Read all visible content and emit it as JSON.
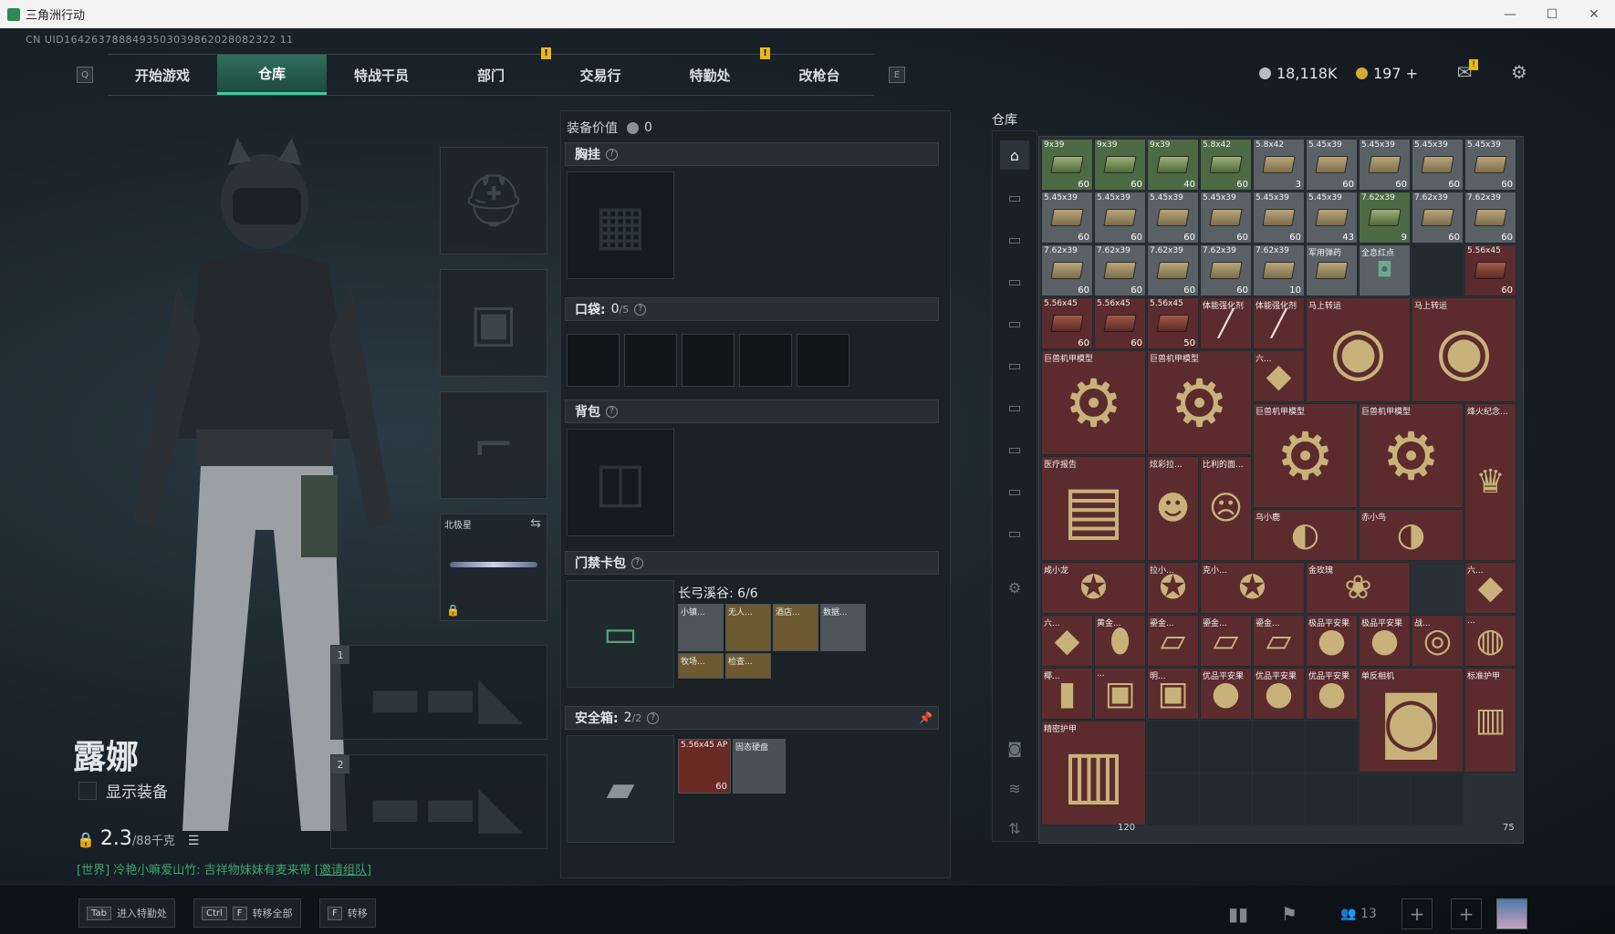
{
  "window": {
    "title": "三角洲行动",
    "controls": [
      "—",
      "☐",
      "✕"
    ]
  },
  "uid": "CN UID1642637888493503039862028082322 11",
  "nav": {
    "left_key": "Q",
    "right_key": "E",
    "tabs": [
      {
        "label": "开始游戏",
        "active": false,
        "alert": false
      },
      {
        "label": "仓库",
        "active": true,
        "alert": false
      },
      {
        "label": "特战干员",
        "active": false,
        "alert": false
      },
      {
        "label": "部门",
        "active": false,
        "alert": true
      },
      {
        "label": "交易行",
        "active": false,
        "alert": false
      },
      {
        "label": "特勤处",
        "active": false,
        "alert": true
      },
      {
        "label": "改枪台",
        "active": false,
        "alert": false
      }
    ],
    "alert_mark": "!"
  },
  "currency": {
    "silver": "18,118K",
    "gold": "197 +"
  },
  "icons": {
    "mail": "mail-icon",
    "settings": "gear-icon"
  },
  "character": {
    "name": "露娜",
    "show_equipment": "显示装备",
    "weight": "2.3",
    "weight_max": "/88千克"
  },
  "chat": {
    "prefix": "[世界] 冷艳小嘛爱山竹: 吉祥物妹妹有麦来带 ",
    "link": "[邀请组队]"
  },
  "gear": {
    "melee_label": "北极星",
    "weapon_slot_1": "1",
    "weapon_slot_2": "2"
  },
  "equipment": {
    "value_label": "装备价值",
    "value": "0",
    "chest_rig": "胸挂",
    "pockets": "口袋:",
    "pockets_count": "0",
    "pockets_max": "/5",
    "backpack": "背包",
    "keycard": "门禁卡包",
    "keycard_map": "长弓溪谷: 6/6",
    "keycard_items": [
      "小镇...",
      "无人...",
      "酒店...",
      "数据...",
      "牧场...",
      "检查..."
    ],
    "safe_box": "安全箱:",
    "safe_count": "2",
    "safe_max": "/2",
    "safe_items": [
      {
        "name": "5.56x45 AP",
        "count": "60"
      },
      {
        "name": "固态硬盘",
        "count": ""
      }
    ],
    "help_mark": "?"
  },
  "warehouse": {
    "title": "仓库",
    "cells": [
      {
        "name": "9x39",
        "count": "60",
        "color": "green",
        "kind": "boxg"
      },
      {
        "name": "9x39",
        "count": "60",
        "color": "green",
        "kind": "boxg"
      },
      {
        "name": "9x39",
        "count": "40",
        "color": "green",
        "kind": "boxg"
      },
      {
        "name": "5.8x42",
        "count": "60",
        "color": "green",
        "kind": "boxg"
      },
      {
        "name": "5.8x42",
        "count": "3",
        "color": "gray",
        "kind": "box"
      },
      {
        "name": "5.45x39",
        "count": "60",
        "color": "gray",
        "kind": "box"
      },
      {
        "name": "5.45x39",
        "count": "60",
        "color": "gray",
        "kind": "box"
      },
      {
        "name": "5.45x39",
        "count": "60",
        "color": "gray",
        "kind": "box"
      },
      {
        "name": "5.45x39",
        "count": "60",
        "color": "gray",
        "kind": "box"
      },
      {
        "name": "5.45x39",
        "count": "60",
        "color": "gray",
        "kind": "box"
      },
      {
        "name": "5.45x39",
        "count": "60",
        "color": "gray",
        "kind": "box"
      },
      {
        "name": "5.45x39",
        "count": "60",
        "color": "gray",
        "kind": "box"
      },
      {
        "name": "5.45x39",
        "count": "60",
        "color": "gray",
        "kind": "box"
      },
      {
        "name": "5.45x39",
        "count": "60",
        "color": "gray",
        "kind": "box"
      },
      {
        "name": "5.45x39",
        "count": "43",
        "color": "gray",
        "kind": "box"
      },
      {
        "name": "7.62x39",
        "count": "9",
        "color": "green",
        "kind": "boxg"
      },
      {
        "name": "7.62x39",
        "count": "60",
        "color": "gray",
        "kind": "box"
      },
      {
        "name": "7.62x39",
        "count": "60",
        "color": "gray",
        "kind": "box"
      },
      {
        "name": "7.62x39",
        "count": "60",
        "color": "gray",
        "kind": "box"
      },
      {
        "name": "7.62x39",
        "count": "60",
        "color": "gray",
        "kind": "box"
      },
      {
        "name": "7.62x39",
        "count": "60",
        "color": "gray",
        "kind": "box"
      },
      {
        "name": "7.62x39",
        "count": "60",
        "color": "gray",
        "kind": "box"
      },
      {
        "name": "7.62x39",
        "count": "10",
        "color": "gray",
        "kind": "box"
      },
      {
        "name": "军用弹药",
        "count": "",
        "color": "gray",
        "kind": "box"
      },
      {
        "name": "全息红点",
        "count": "",
        "color": "gray",
        "kind": "sight"
      },
      {
        "name": "",
        "count": "",
        "color": "empty",
        "kind": ""
      },
      {
        "name": "5.56x45",
        "count": "60",
        "color": "red",
        "kind": "boxr"
      },
      {
        "name": "5.56x45",
        "count": "60",
        "color": "red",
        "kind": "boxr"
      },
      {
        "name": "5.56x45",
        "count": "60",
        "color": "red",
        "kind": "boxr"
      },
      {
        "name": "5.56x45",
        "count": "50",
        "color": "red",
        "kind": "boxr"
      },
      {
        "name": "体能强化剂",
        "count": "",
        "color": "red",
        "kind": "syringe"
      },
      {
        "name": "体能强化剂",
        "count": "",
        "color": "red",
        "kind": "syringe"
      }
    ],
    "big_items": [
      {
        "name": "马上转运",
        "color": "red",
        "glyph": "◉"
      },
      {
        "name": "马上转运",
        "color": "red",
        "glyph": "◉"
      },
      {
        "name": "巨兽机甲模型",
        "color": "red",
        "glyph": "⚙"
      },
      {
        "name": "巨兽机甲模型",
        "color": "red",
        "glyph": "⚙"
      },
      {
        "name": "六...",
        "color": "red",
        "glyph": "◆"
      },
      {
        "name": "巨兽机甲模型",
        "color": "red",
        "glyph": "⚙"
      },
      {
        "name": "巨兽机甲模型",
        "color": "red",
        "glyph": "⚙"
      },
      {
        "name": "烽火纪念...",
        "color": "red",
        "glyph": "♛"
      },
      {
        "name": "医疗报告",
        "color": "red",
        "glyph": "▤"
      },
      {
        "name": "炫彩拉...",
        "color": "red",
        "glyph": "☻"
      },
      {
        "name": "比利的面...",
        "color": "red",
        "glyph": "☹"
      },
      {
        "name": "乌小鹿",
        "color": "red",
        "glyph": "◐"
      },
      {
        "name": "赤小鸟",
        "color": "red",
        "glyph": "◑"
      },
      {
        "name": "咸小龙",
        "color": "red",
        "glyph": "✪"
      },
      {
        "name": "拉小...",
        "color": "red",
        "glyph": "✪"
      },
      {
        "name": "克小...",
        "color": "red",
        "glyph": "✪"
      },
      {
        "name": "金玫瑰",
        "color": "red",
        "glyph": "❀"
      },
      {
        "name": "六...",
        "color": "red",
        "glyph": "◆"
      },
      {
        "name": "六...",
        "color": "red",
        "glyph": "◆"
      },
      {
        "name": "黄金...",
        "color": "red",
        "glyph": "⬮"
      },
      {
        "name": "鎏金...",
        "color": "red",
        "glyph": "▱"
      },
      {
        "name": "鎏金...",
        "color": "red",
        "glyph": "▱"
      },
      {
        "name": "鎏金...",
        "color": "red",
        "glyph": "▱"
      },
      {
        "name": "极品平安果",
        "color": "red",
        "glyph": "●"
      },
      {
        "name": "极品平安果",
        "color": "red",
        "glyph": "●"
      },
      {
        "name": "战...",
        "color": "red",
        "glyph": "◎"
      },
      {
        "name": "...",
        "color": "red",
        "glyph": "◍"
      },
      {
        "name": "椰...",
        "color": "red",
        "glyph": "▮"
      },
      {
        "name": "...",
        "color": "red",
        "glyph": "▣"
      },
      {
        "name": "明...",
        "color": "red",
        "glyph": "▣"
      },
      {
        "name": "优品平安果",
        "color": "red",
        "glyph": "●"
      },
      {
        "name": "优品平安果",
        "color": "red",
        "glyph": "●"
      },
      {
        "name": "优品平安果",
        "color": "red",
        "glyph": "●"
      },
      {
        "name": "单反相机",
        "color": "red",
        "glyph": "◙"
      },
      {
        "name": "标准护甲",
        "color": "red",
        "glyph": "▥"
      },
      {
        "name": "精密护甲",
        "color": "red",
        "glyph": "▥"
      }
    ],
    "durability_1": "120",
    "durability_2": "75"
  },
  "bottom": {
    "hints": [
      {
        "key1": "Tab",
        "key2": "",
        "label": "进入特勤处"
      },
      {
        "key1": "Ctrl",
        "key2": "F",
        "label": "转移全部"
      },
      {
        "key1": "F",
        "key2": "",
        "label": "转移"
      }
    ],
    "squad_count": "13"
  },
  "colors": {
    "accent": "#2fd39a",
    "alert": "#e8b917",
    "red_item": "#5b2b2d",
    "gold": "#d4aa36"
  }
}
